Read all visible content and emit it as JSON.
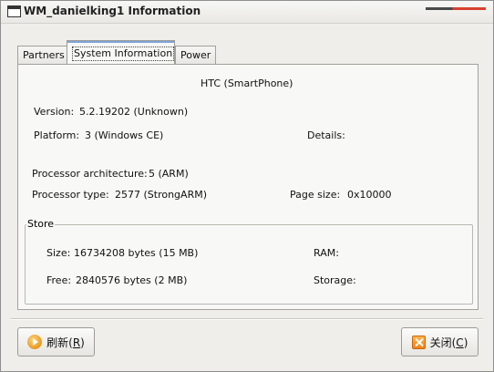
{
  "window": {
    "title": "WM_danielking1  Information"
  },
  "tabs": [
    {
      "label": "Partners",
      "active": false
    },
    {
      "label": "System Information",
      "active": true
    },
    {
      "label": "Power",
      "active": false
    }
  ],
  "system_info": {
    "device": "HTC (SmartPhone)",
    "version_label": "Version:",
    "version_value": "5.2.19202 (Unknown)",
    "platform_label": "Platform:",
    "platform_value": "3 (Windows CE)",
    "details_label": "Details:",
    "proc_arch_label": "Processor architecture:",
    "proc_arch_value": "5 (ARM)",
    "proc_type_label": "Processor type:",
    "proc_type_value": "2577 (StrongARM)",
    "page_size_label": "Page size:",
    "page_size_value": "0x10000"
  },
  "store": {
    "legend": "Store",
    "size_label": "Size:",
    "size_value": "16734208 bytes (15 MB)",
    "free_label": "Free:",
    "free_value": "2840576 bytes (2 MB)",
    "ram_label": "RAM:",
    "storage_label": "Storage:"
  },
  "buttons": {
    "refresh_label": "刷新(",
    "refresh_key": "R",
    "refresh_end": ")",
    "close_label": "关闭(",
    "close_key": "C",
    "close_end": ")"
  },
  "colors": {
    "accent_tab": "#7fa4d9",
    "title_accent_red": "#d8412f",
    "icon_orange": "#f0811a"
  }
}
